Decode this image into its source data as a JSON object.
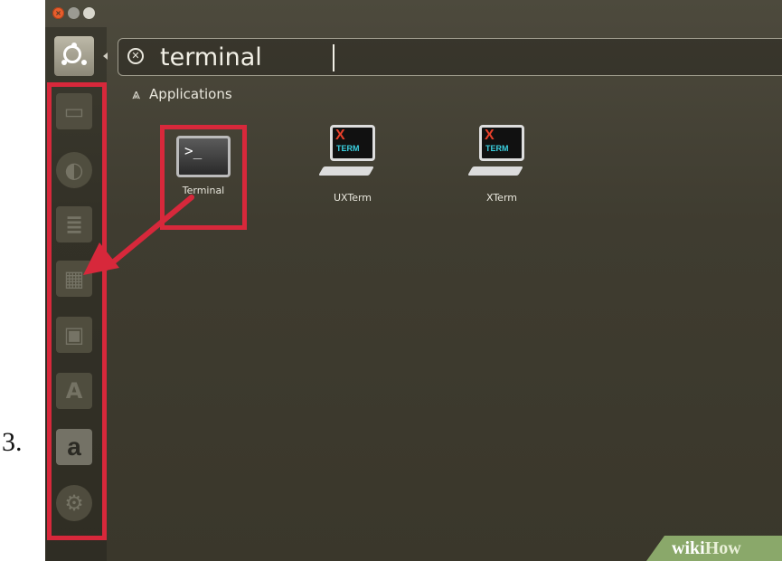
{
  "step_number": "3.",
  "search": {
    "query": "terminal",
    "clear_icon": "close-circle-icon"
  },
  "category": {
    "label": "Applications",
    "icon": "applications-icon"
  },
  "apps": [
    {
      "label": "Terminal",
      "icon": "terminal-icon"
    },
    {
      "label": "UXTerm",
      "icon": "xterm-icon"
    },
    {
      "label": "XTerm",
      "icon": "xterm-icon"
    }
  ],
  "launcher": {
    "items": [
      {
        "icon": "file-manager-icon"
      },
      {
        "icon": "firefox-icon"
      },
      {
        "icon": "writer-icon"
      },
      {
        "icon": "calc-icon"
      },
      {
        "icon": "impress-icon"
      },
      {
        "icon": "software-center-icon"
      },
      {
        "icon": "amazon-icon",
        "glyph": "a"
      },
      {
        "icon": "settings-icon"
      }
    ]
  },
  "watermark": {
    "wiki": "wiki",
    "how": "How"
  },
  "colors": {
    "highlight": "#d7283b",
    "background": "#3f3c30",
    "watermark": "#8aa86a"
  }
}
